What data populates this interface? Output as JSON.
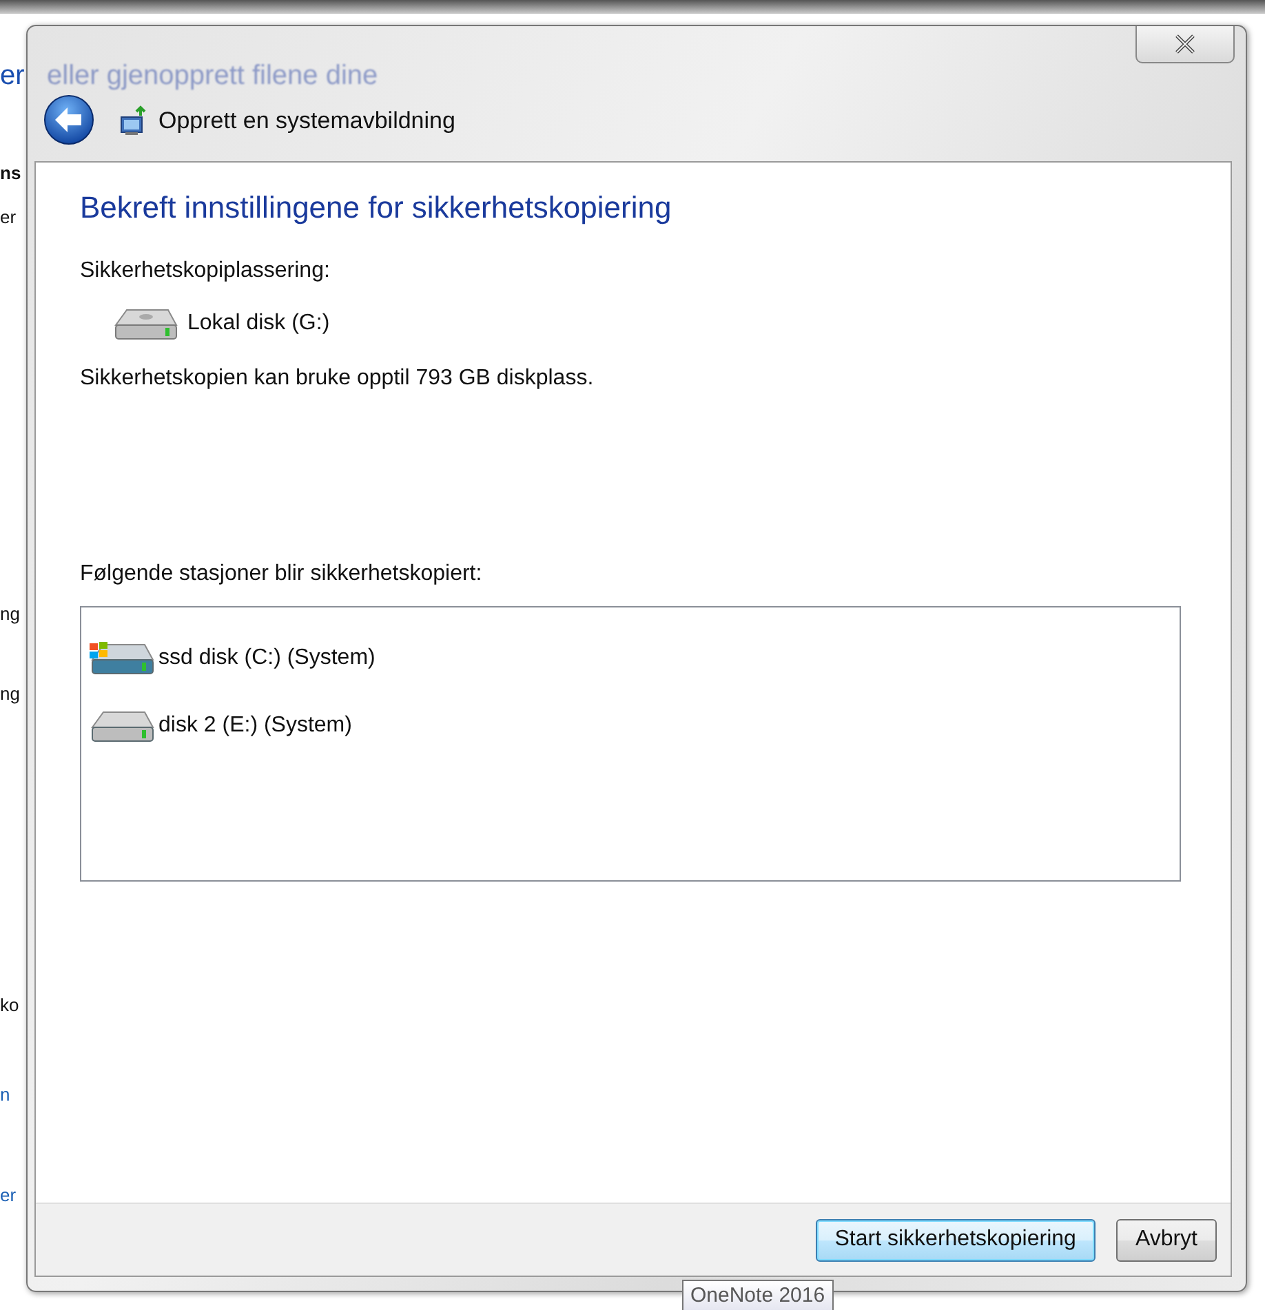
{
  "background": {
    "title_start": "er",
    "title_rest": "eller gjenopprett filene dine",
    "fragments": [
      {
        "text": "ns",
        "kind": "bold"
      },
      {
        "text": "er",
        "kind": "plain"
      },
      {
        "text": "ng",
        "kind": "plain"
      },
      {
        "text": "ng",
        "kind": "plain"
      },
      {
        "text": "ko",
        "kind": "plain"
      },
      {
        "text": "n",
        "kind": "link"
      },
      {
        "text": "er",
        "kind": "link"
      }
    ]
  },
  "dialog": {
    "nav_title": "Opprett en systemavbildning",
    "heading": "Bekreft innstillingene for sikkerhetskopiering",
    "location_label": "Sikkerhetskopiplassering:",
    "location": {
      "name": "Lokal disk (G:)",
      "kind": "drive"
    },
    "space_note": "Sikkerhetskopien kan bruke opptil 793 GB diskplass.",
    "drives_label": "Følgende stasjoner blir sikkerhetskopiert:",
    "drives": [
      {
        "name": "ssd disk (C:) (System)",
        "kind": "system"
      },
      {
        "name": "disk 2 (E:) (System)",
        "kind": "drive"
      }
    ],
    "buttons": [
      {
        "label": "Start sikkerhetskopiering",
        "default": true
      },
      {
        "label": "Avbryt",
        "default": false
      }
    ]
  },
  "tooltip": "OneNote 2016"
}
